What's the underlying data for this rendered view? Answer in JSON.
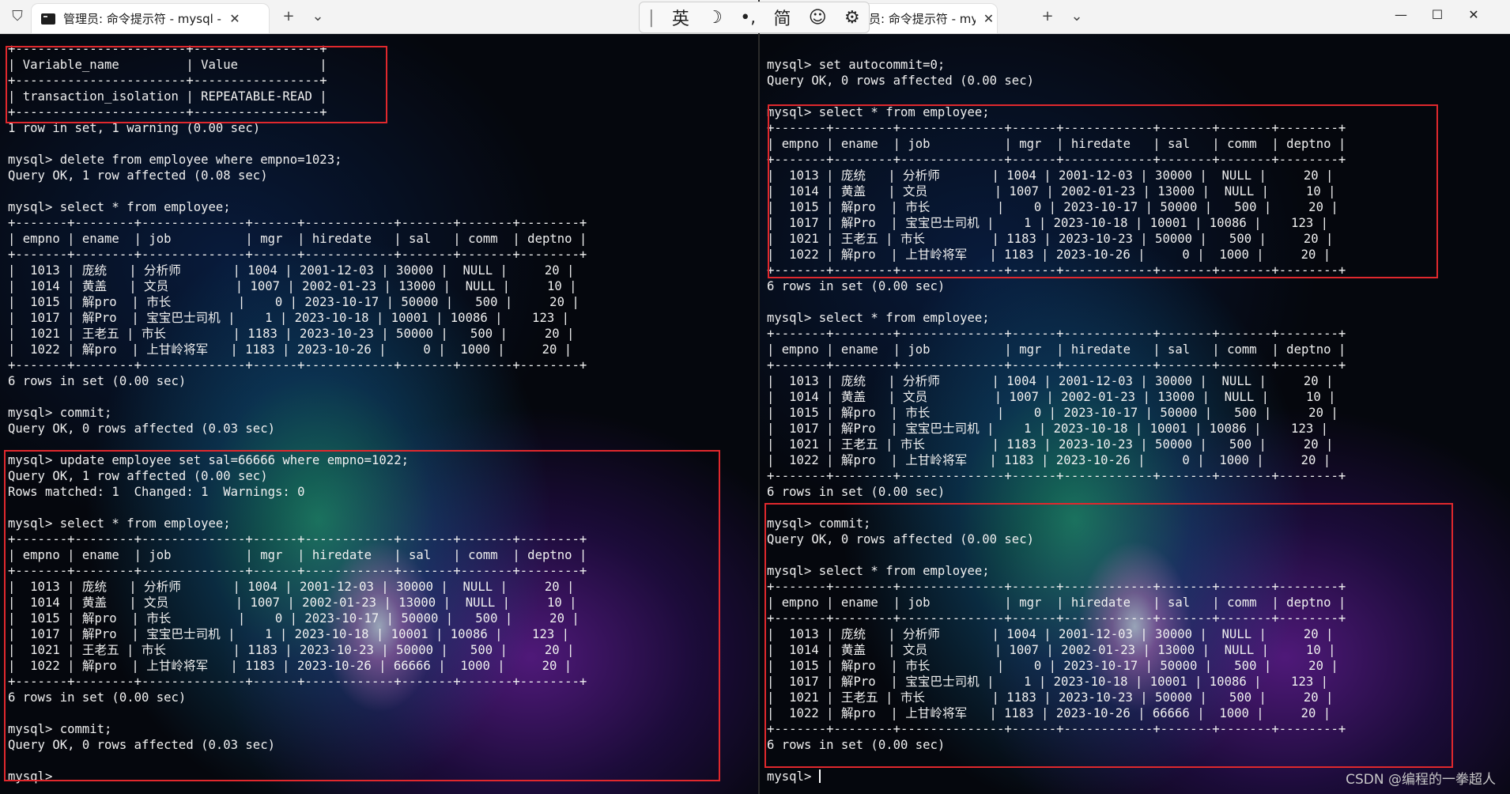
{
  "left": {
    "tab_title": "管理员: 命令提示符 - mysql -u",
    "lines": [
      "+-----------------------+-----------------+",
      "| Variable_name         | Value           |",
      "+-----------------------+-----------------+",
      "| transaction_isolation | REPEATABLE-READ |",
      "+-----------------------+-----------------+",
      "1 row in set, 1 warning (0.00 sec)",
      "",
      "mysql> delete from employee where empno=1023;",
      "Query OK, 1 row affected (0.08 sec)",
      "",
      "mysql> select * from employee;",
      "+-------+--------+--------------+------+------------+-------+-------+--------+",
      "| empno | ename  | job          | mgr  | hiredate   | sal   | comm  | deptno |",
      "+-------+--------+--------------+------+------------+-------+-------+--------+",
      "|  1013 | 庞统   | 分析师       | 1004 | 2001-12-03 | 30000 |  NULL |     20 |",
      "|  1014 | 黄盖   | 文员         | 1007 | 2002-01-23 | 13000 |  NULL |     10 |",
      "|  1015 | 解pro  | 市长         |    0 | 2023-10-17 | 50000 |   500 |     20 |",
      "|  1017 | 解Pro  | 宝宝巴士司机 |    1 | 2023-10-18 | 10001 | 10086 |    123 |",
      "|  1021 | 王老五 | 市长         | 1183 | 2023-10-23 | 50000 |   500 |     20 |",
      "|  1022 | 解pro  | 上甘岭将军   | 1183 | 2023-10-26 |     0 |  1000 |     20 |",
      "+-------+--------+--------------+------+------------+-------+-------+--------+",
      "6 rows in set (0.00 sec)",
      "",
      "mysql> commit;",
      "Query OK, 0 rows affected (0.03 sec)",
      "",
      "mysql> update employee set sal=66666 where empno=1022;",
      "Query OK, 1 row affected (0.00 sec)",
      "Rows matched: 1  Changed: 1  Warnings: 0",
      "",
      "mysql> select * from employee;",
      "+-------+--------+--------------+------+------------+-------+-------+--------+",
      "| empno | ename  | job          | mgr  | hiredate   | sal   | comm  | deptno |",
      "+-------+--------+--------------+------+------------+-------+-------+--------+",
      "|  1013 | 庞统   | 分析师       | 1004 | 2001-12-03 | 30000 |  NULL |     20 |",
      "|  1014 | 黄盖   | 文员         | 1007 | 2002-01-23 | 13000 |  NULL |     10 |",
      "|  1015 | 解pro  | 市长         |    0 | 2023-10-17 | 50000 |   500 |     20 |",
      "|  1017 | 解Pro  | 宝宝巴士司机 |    1 | 2023-10-18 | 10001 | 10086 |    123 |",
      "|  1021 | 王老五 | 市长         | 1183 | 2023-10-23 | 50000 |   500 |     20 |",
      "|  1022 | 解pro  | 上甘岭将军   | 1183 | 2023-10-26 | 66666 |  1000 |     20 |",
      "+-------+--------+--------------+------+------------+-------+-------+--------+",
      "6 rows in set (0.00 sec)",
      "",
      "mysql> commit;",
      "Query OK, 0 rows affected (0.03 sec)",
      "",
      "mysql>"
    ]
  },
  "right": {
    "tab_title": "员: 命令提示符 - mysql -u",
    "lines": [
      "mysql> set autocommit=0;",
      "Query OK, 0 rows affected (0.00 sec)",
      "",
      "mysql> select * from employee;",
      "+-------+--------+--------------+------+------------+-------+-------+--------+",
      "| empno | ename  | job          | mgr  | hiredate   | sal   | comm  | deptno |",
      "+-------+--------+--------------+------+------------+-------+-------+--------+",
      "|  1013 | 庞统   | 分析师       | 1004 | 2001-12-03 | 30000 |  NULL |     20 |",
      "|  1014 | 黄盖   | 文员         | 1007 | 2002-01-23 | 13000 |  NULL |     10 |",
      "|  1015 | 解pro  | 市长         |    0 | 2023-10-17 | 50000 |   500 |     20 |",
      "|  1017 | 解Pro  | 宝宝巴士司机 |    1 | 2023-10-18 | 10001 | 10086 |    123 |",
      "|  1021 | 王老五 | 市长         | 1183 | 2023-10-23 | 50000 |   500 |     20 |",
      "|  1022 | 解pro  | 上甘岭将军   | 1183 | 2023-10-26 |     0 |  1000 |     20 |",
      "+-------+--------+--------------+------+------------+-------+-------+--------+",
      "6 rows in set (0.00 sec)",
      "",
      "mysql> select * from employee;",
      "+-------+--------+--------------+------+------------+-------+-------+--------+",
      "| empno | ename  | job          | mgr  | hiredate   | sal   | comm  | deptno |",
      "+-------+--------+--------------+------+------------+-------+-------+--------+",
      "|  1013 | 庞统   | 分析师       | 1004 | 2001-12-03 | 30000 |  NULL |     20 |",
      "|  1014 | 黄盖   | 文员         | 1007 | 2002-01-23 | 13000 |  NULL |     10 |",
      "|  1015 | 解pro  | 市长         |    0 | 2023-10-17 | 50000 |   500 |     20 |",
      "|  1017 | 解Pro  | 宝宝巴士司机 |    1 | 2023-10-18 | 10001 | 10086 |    123 |",
      "|  1021 | 王老五 | 市长         | 1183 | 2023-10-23 | 50000 |   500 |     20 |",
      "|  1022 | 解pro  | 上甘岭将军   | 1183 | 2023-10-26 |     0 |  1000 |     20 |",
      "+-------+--------+--------------+------+------------+-------+-------+--------+",
      "6 rows in set (0.00 sec)",
      "",
      "mysql> commit;",
      "Query OK, 0 rows affected (0.00 sec)",
      "",
      "mysql> select * from employee;",
      "+-------+--------+--------------+------+------------+-------+-------+--------+",
      "| empno | ename  | job          | mgr  | hiredate   | sal   | comm  | deptno |",
      "+-------+--------+--------------+------+------------+-------+-------+--------+",
      "|  1013 | 庞统   | 分析师       | 1004 | 2001-12-03 | 30000 |  NULL |     20 |",
      "|  1014 | 黄盖   | 文员         | 1007 | 2002-01-23 | 13000 |  NULL |     10 |",
      "|  1015 | 解pro  | 市长         |    0 | 2023-10-17 | 50000 |   500 |     20 |",
      "|  1017 | 解Pro  | 宝宝巴士司机 |    1 | 2023-10-18 | 10001 | 10086 |    123 |",
      "|  1021 | 王老五 | 市长         | 1183 | 2023-10-23 | 50000 |   500 |     20 |",
      "|  1022 | 解pro  | 上甘岭将军   | 1183 | 2023-10-26 | 66666 |  1000 |     20 |",
      "+-------+--------+--------------+------+------------+-------+-------+--------+",
      "6 rows in set (0.00 sec)",
      "",
      "mysql> "
    ]
  },
  "ime": {
    "lang": "英",
    "moon": "☽",
    "punct": "•,",
    "mode": "简",
    "emoji": "☺",
    "settings": "⚙"
  },
  "tabbar": {
    "new_tab": "+",
    "dropdown": "⌄",
    "close": "✕",
    "minimize": "—",
    "maximize": "☐",
    "window_close": "✕"
  },
  "watermark": "CSDN @编程的一拳超人",
  "colors": {
    "highlight": "#e0282d",
    "terminal_text": "#f0f0f0"
  }
}
